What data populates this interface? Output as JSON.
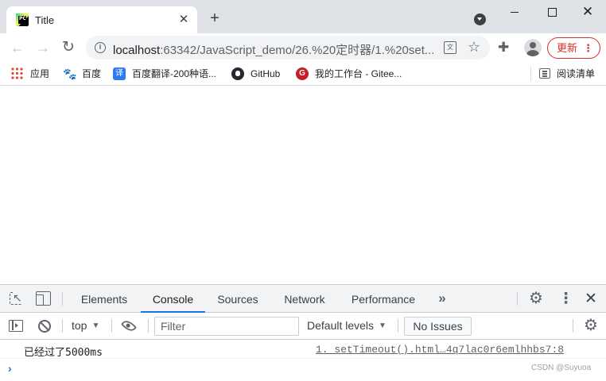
{
  "browser": {
    "tab": {
      "title": "Title",
      "favicon_text": "PC",
      "favicon": "pycharm-icon",
      "close_glyph": "✕"
    },
    "new_tab_glyph": "+",
    "window": {
      "close_glyph": "✕"
    },
    "toolbar": {
      "back_glyph": "←",
      "forward_glyph": "→",
      "reload_glyph": "↻",
      "url_host": "localhost",
      "url_path": ":63342/JavaScript_demo/26.%20定时器/1.%20set...",
      "translate_glyph": "文",
      "bookmark_glyph": "☆",
      "extensions_glyph": "✚",
      "update_label": "更新",
      "update_menu_glyph": "⋮",
      "accent_color": "#d93025"
    },
    "bookmarks": [
      {
        "label": "应用",
        "icon": "apps-icon"
      },
      {
        "label": "百度",
        "icon": "baidu-paw-icon",
        "glyph": "🐾"
      },
      {
        "label": "百度翻译-200种语...",
        "icon": "baidu-translate-icon",
        "glyph": "译"
      },
      {
        "label": "GitHub",
        "icon": "github-icon"
      },
      {
        "label": "我的工作台 - Gitee...",
        "icon": "gitee-icon",
        "glyph": "G"
      }
    ],
    "reading_list": {
      "label": "阅读清单",
      "icon": "reading-list-icon"
    }
  },
  "devtools": {
    "tabs": [
      {
        "label": "Elements",
        "active": false
      },
      {
        "label": "Console",
        "active": true
      },
      {
        "label": "Sources",
        "active": false
      },
      {
        "label": "Network",
        "active": false
      },
      {
        "label": "Performance",
        "active": false
      }
    ],
    "more_tabs_glyph": "»",
    "settings_glyph": "⚙",
    "menu_glyph": "⋮",
    "close_glyph": "✕",
    "active_tab_color": "#1a73e8",
    "console_toolbar": {
      "context": "top",
      "context_caret": "▼",
      "filter_placeholder": "Filter",
      "levels": "Default levels",
      "levels_caret": "▼",
      "issues": "No Issues"
    },
    "messages": [
      {
        "text": "已经过了5000ms",
        "source": "1. setTimeout().html…4q7lac0r6emlhhbs7:8"
      }
    ],
    "prompt_glyph": "›"
  },
  "watermark": "CSDN @Suyuoa"
}
